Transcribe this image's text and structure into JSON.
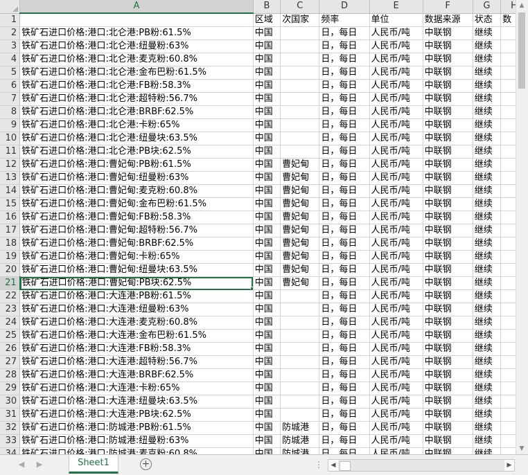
{
  "columns": [
    "A",
    "B",
    "C",
    "D",
    "E",
    "F",
    "G",
    "H"
  ],
  "selected_column": "A",
  "selected_row": 21,
  "rows": [
    {
      "n": "1",
      "c": [
        "",
        "区域",
        "次国家",
        "频率",
        "单位",
        "数据来源",
        "状态",
        "数"
      ]
    },
    {
      "n": "2",
      "c": [
        "铁矿石进口价格:港口:北仑港:PB粉:61.5%",
        "中国",
        "",
        "日，每日",
        "人民币/吨",
        "中联钢",
        "继续",
        ""
      ]
    },
    {
      "n": "3",
      "c": [
        "铁矿石进口价格:港口:北仑港:纽曼粉:63%",
        "中国",
        "",
        "日，每日",
        "人民币/吨",
        "中联钢",
        "继续",
        ""
      ]
    },
    {
      "n": "4",
      "c": [
        "铁矿石进口价格:港口:北仑港:麦克粉:60.8%",
        "中国",
        "",
        "日，每日",
        "人民币/吨",
        "中联钢",
        "继续",
        ""
      ]
    },
    {
      "n": "5",
      "c": [
        "铁矿石进口价格:港口:北仑港:金布巴粉:61.5%",
        "中国",
        "",
        "日，每日",
        "人民币/吨",
        "中联钢",
        "继续",
        ""
      ]
    },
    {
      "n": "6",
      "c": [
        "铁矿石进口价格:港口:北仑港:FB粉:58.3%",
        "中国",
        "",
        "日，每日",
        "人民币/吨",
        "中联钢",
        "继续",
        ""
      ]
    },
    {
      "n": "7",
      "c": [
        "铁矿石进口价格:港口:北仑港:超特粉:56.7%",
        "中国",
        "",
        "日，每日",
        "人民币/吨",
        "中联钢",
        "继续",
        ""
      ]
    },
    {
      "n": "8",
      "c": [
        "铁矿石进口价格:港口:北仑港:BRBF:62.5%",
        "中国",
        "",
        "日，每日",
        "人民币/吨",
        "中联钢",
        "继续",
        ""
      ]
    },
    {
      "n": "9",
      "c": [
        "铁矿石进口价格:港口:北仑港:卡粉:65%",
        "中国",
        "",
        "日，每日",
        "人民币/吨",
        "中联钢",
        "继续",
        ""
      ]
    },
    {
      "n": "10",
      "c": [
        "铁矿石进口价格:港口:北仑港:纽曼块:63.5%",
        "中国",
        "",
        "日，每日",
        "人民币/吨",
        "中联钢",
        "继续",
        ""
      ]
    },
    {
      "n": "11",
      "c": [
        "铁矿石进口价格:港口:北仑港:PB块:62.5%",
        "中国",
        "",
        "日，每日",
        "人民币/吨",
        "中联钢",
        "继续",
        ""
      ]
    },
    {
      "n": "12",
      "c": [
        "铁矿石进口价格:港口:曹妃甸:PB粉:61.5%",
        "中国",
        "曹妃甸",
        "日，每日",
        "人民币/吨",
        "中联钢",
        "继续",
        ""
      ]
    },
    {
      "n": "13",
      "c": [
        "铁矿石进口价格:港口:曹妃甸:纽曼粉:63%",
        "中国",
        "曹妃甸",
        "日，每日",
        "人民币/吨",
        "中联钢",
        "继续",
        ""
      ]
    },
    {
      "n": "14",
      "c": [
        "铁矿石进口价格:港口:曹妃甸:麦克粉:60.8%",
        "中国",
        "曹妃甸",
        "日，每日",
        "人民币/吨",
        "中联钢",
        "继续",
        ""
      ]
    },
    {
      "n": "15",
      "c": [
        "铁矿石进口价格:港口:曹妃甸:金布巴粉:61.5%",
        "中国",
        "曹妃甸",
        "日，每日",
        "人民币/吨",
        "中联钢",
        "继续",
        ""
      ]
    },
    {
      "n": "16",
      "c": [
        "铁矿石进口价格:港口:曹妃甸:FB粉:58.3%",
        "中国",
        "曹妃甸",
        "日，每日",
        "人民币/吨",
        "中联钢",
        "继续",
        ""
      ]
    },
    {
      "n": "17",
      "c": [
        "铁矿石进口价格:港口:曹妃甸:超特粉:56.7%",
        "中国",
        "曹妃甸",
        "日，每日",
        "人民币/吨",
        "中联钢",
        "继续",
        ""
      ]
    },
    {
      "n": "18",
      "c": [
        "铁矿石进口价格:港口:曹妃甸:BRBF:62.5%",
        "中国",
        "曹妃甸",
        "日，每日",
        "人民币/吨",
        "中联钢",
        "继续",
        ""
      ]
    },
    {
      "n": "19",
      "c": [
        "铁矿石进口价格:港口:曹妃甸:卡粉:65%",
        "中国",
        "曹妃甸",
        "日，每日",
        "人民币/吨",
        "中联钢",
        "继续",
        ""
      ]
    },
    {
      "n": "20",
      "c": [
        "铁矿石进口价格:港口:曹妃甸:纽曼块:63.5%",
        "中国",
        "曹妃甸",
        "日，每日",
        "人民币/吨",
        "中联钢",
        "继续",
        ""
      ]
    },
    {
      "n": "21",
      "c": [
        "铁矿石进口价格:港口:曹妃甸:PB块:62.5%",
        "中国",
        "曹妃甸",
        "日，每日",
        "人民币/吨",
        "中联钢",
        "继续",
        ""
      ]
    },
    {
      "n": "22",
      "c": [
        "铁矿石进口价格:港口:大连港:PB粉:61.5%",
        "中国",
        "",
        "日，每日",
        "人民币/吨",
        "中联钢",
        "继续",
        ""
      ]
    },
    {
      "n": "23",
      "c": [
        "铁矿石进口价格:港口:大连港:纽曼粉:63%",
        "中国",
        "",
        "日，每日",
        "人民币/吨",
        "中联钢",
        "继续",
        ""
      ]
    },
    {
      "n": "24",
      "c": [
        "铁矿石进口价格:港口:大连港:麦克粉:60.8%",
        "中国",
        "",
        "日，每日",
        "人民币/吨",
        "中联钢",
        "继续",
        ""
      ]
    },
    {
      "n": "25",
      "c": [
        "铁矿石进口价格:港口:大连港:金布巴粉:61.5%",
        "中国",
        "",
        "日，每日",
        "人民币/吨",
        "中联钢",
        "继续",
        ""
      ]
    },
    {
      "n": "26",
      "c": [
        "铁矿石进口价格:港口:大连港:FB粉:58.3%",
        "中国",
        "",
        "日，每日",
        "人民币/吨",
        "中联钢",
        "继续",
        ""
      ]
    },
    {
      "n": "27",
      "c": [
        "铁矿石进口价格:港口:大连港:超特粉:56.7%",
        "中国",
        "",
        "日，每日",
        "人民币/吨",
        "中联钢",
        "继续",
        ""
      ]
    },
    {
      "n": "28",
      "c": [
        "铁矿石进口价格:港口:大连港:BRBF:62.5%",
        "中国",
        "",
        "日，每日",
        "人民币/吨",
        "中联钢",
        "继续",
        ""
      ]
    },
    {
      "n": "29",
      "c": [
        "铁矿石进口价格:港口:大连港:卡粉:65%",
        "中国",
        "",
        "日，每日",
        "人民币/吨",
        "中联钢",
        "继续",
        ""
      ]
    },
    {
      "n": "30",
      "c": [
        "铁矿石进口价格:港口:大连港:纽曼块:63.5%",
        "中国",
        "",
        "日，每日",
        "人民币/吨",
        "中联钢",
        "继续",
        ""
      ]
    },
    {
      "n": "31",
      "c": [
        "铁矿石进口价格:港口:大连港:PB块:62.5%",
        "中国",
        "",
        "日，每日",
        "人民币/吨",
        "中联钢",
        "继续",
        ""
      ]
    },
    {
      "n": "32",
      "c": [
        "铁矿石进口价格:港口:防城港:PB粉:61.5%",
        "中国",
        "防城港",
        "日，每日",
        "人民币/吨",
        "中联钢",
        "继续",
        ""
      ]
    },
    {
      "n": "33",
      "c": [
        "铁矿石进口价格:港口:防城港:纽曼粉:63%",
        "中国",
        "防城港",
        "日，每日",
        "人民币/吨",
        "中联钢",
        "继续",
        ""
      ]
    },
    {
      "n": "34",
      "c": [
        "铁矿石进口价格:港口:防城港:麦克粉:60.8%",
        "中国",
        "防城港",
        "日，每日",
        "人民币/吨",
        "中联钢",
        "继续",
        ""
      ]
    }
  ],
  "sheet_tabs": [
    {
      "label": "Sheet1",
      "active": true
    }
  ],
  "icons": {
    "add_sheet": "plus-circle-icon",
    "prev_sheet": "chevron-left-icon",
    "next_sheet": "chevron-right-icon"
  },
  "colors": {
    "accent": "#217346",
    "header_bg": "#e6e6e6"
  }
}
